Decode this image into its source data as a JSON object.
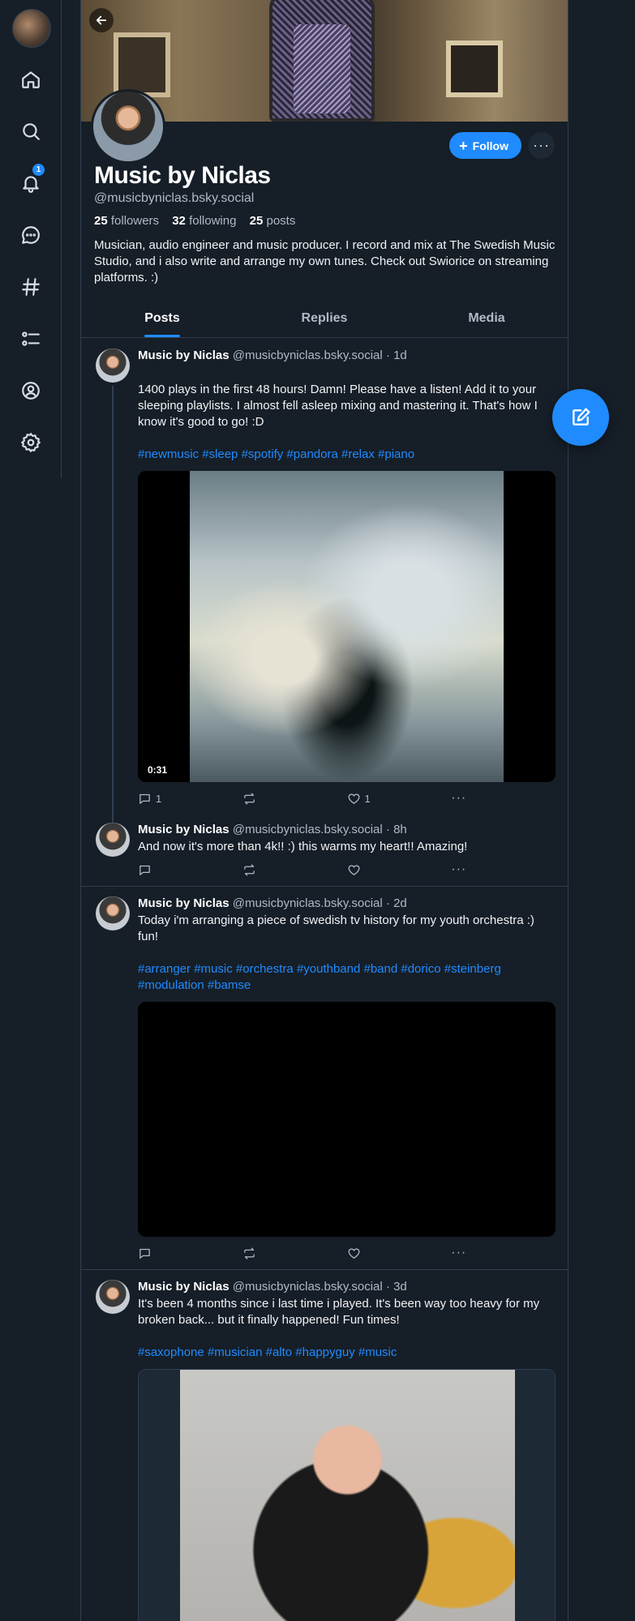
{
  "nav": {
    "notifications_count": "1",
    "items": [
      "home-icon",
      "search-icon",
      "bell-icon",
      "chat-icon",
      "hashtag-icon",
      "list-icon",
      "profile-icon",
      "gear-icon"
    ]
  },
  "profile": {
    "display_name": "Music by Niclas",
    "handle": "@musicbyniclas.bsky.social",
    "followers_count": "25",
    "followers_label": "followers",
    "following_count": "32",
    "following_label": "following",
    "posts_count": "25",
    "posts_label": "posts",
    "bio": "Musician, audio engineer and music producer. I record and mix at The Swedish Music Studio, and i also write and arrange my own tunes. Check out Swiorice on streaming platforms. :)",
    "follow_label": "Follow",
    "more_label": "···"
  },
  "tabs": [
    {
      "label": "Posts",
      "active": true
    },
    {
      "label": "Replies",
      "active": false
    },
    {
      "label": "Media",
      "active": false
    }
  ],
  "posts": [
    {
      "author": "Music by Niclas",
      "handle": "@musicbyniclas.bsky.social",
      "time": "· 1d",
      "text": "1400 plays in the first 48 hours! Damn! Please have a listen! Add it to your sleeping playlists. I almost fell asleep mixing and mastering it. That's how I know it's good to go! :D",
      "tags": "#newmusic #sleep #spotify #pandora #relax #piano",
      "video_duration": "0:31",
      "replies": "1",
      "reposts": "",
      "likes": "1"
    },
    {
      "author": "Music by Niclas",
      "handle": "@musicbyniclas.bsky.social",
      "time": "· 8h",
      "text": "And now it's more than 4k!! :) this warms my heart!! Amazing!",
      "replies": "",
      "reposts": "",
      "likes": ""
    },
    {
      "author": "Music by Niclas",
      "handle": "@musicbyniclas.bsky.social",
      "time": "· 2d",
      "text": "Today i'm arranging a piece of swedish tv history for my youth orchestra :) fun!",
      "tags": "#arranger #music #orchestra #youthband #band #dorico #steinberg #modulation #bamse",
      "replies": "",
      "reposts": "",
      "likes": ""
    },
    {
      "author": "Music by Niclas",
      "handle": "@musicbyniclas.bsky.social",
      "time": "· 3d",
      "text": "It's been 4 months since i last time i played. It's been way too heavy for my broken back... but it finally happened! Fun times!",
      "tags": "#saxophone #musician #alto #happyguy #music"
    }
  ],
  "more_glyph": "···"
}
